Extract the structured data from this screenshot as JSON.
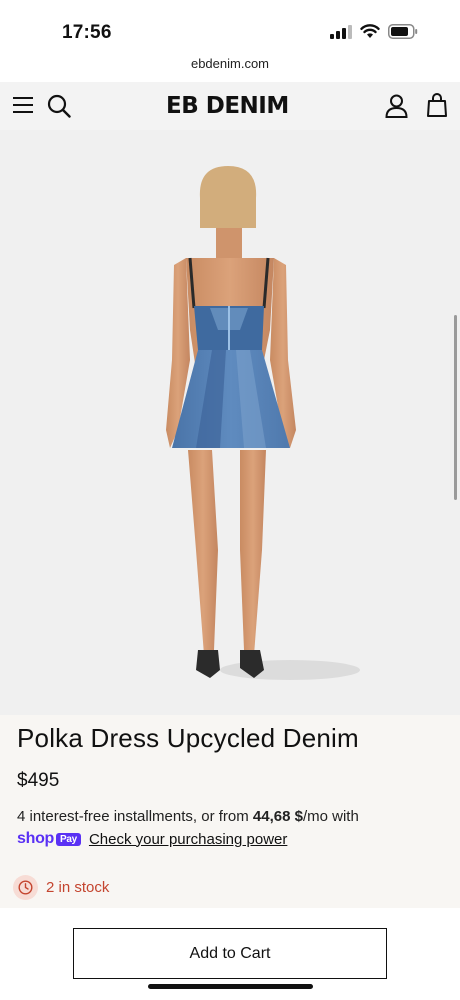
{
  "status": {
    "time": "17:56"
  },
  "browser": {
    "url": "ebdenim.com"
  },
  "header": {
    "logo": "EB DENIM"
  },
  "product": {
    "title": "Polka Dress Upcycled Denim",
    "price": "$495",
    "installments_prefix": "4 interest-free installments, or from ",
    "installments_amount": "44,68 $",
    "installments_suffix": "/mo with",
    "shop_brand": "shop",
    "shop_pay_badge": "Pay",
    "check_power": "Check your purchasing power",
    "stock": "2 in stock"
  },
  "cart": {
    "add_label": "Add to Cart"
  },
  "icons": [
    "signal-icon",
    "wifi-icon",
    "battery-icon",
    "menu-icon",
    "search-icon",
    "account-icon",
    "bag-icon",
    "clock-icon"
  ],
  "colors": {
    "stock_red": "#c4452f",
    "shop_purple": "#5a31f4",
    "info_bg": "#f8f6f3"
  }
}
